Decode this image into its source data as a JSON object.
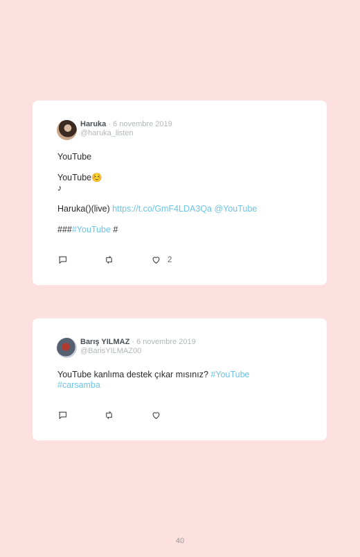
{
  "tweets": [
    {
      "name": "Haruka",
      "date": "6 novembre 2019",
      "handle": "@haruka_listen",
      "line1": "YouTube",
      "line2": "YouTube☺️",
      "line3": "♪",
      "line4_text": "Haruka()(live) ",
      "line4_link1": "https://t.co/GmF4LDA3Qa",
      "line4_link2": " @YouTube",
      "line5_text": "###",
      "line5_link": "#YouTube",
      "line5_tail": " #",
      "like_count": "2"
    },
    {
      "name": "Barış YILMAZ",
      "date": "6 novembre 2019",
      "handle": "@BarisYILMAZ00",
      "text": "YouTube kanlıma destek çıkar mısınız? ",
      "link1": "#YouTube",
      "link2": "#carsamba"
    }
  ],
  "separator": "·",
  "page_number": "40"
}
